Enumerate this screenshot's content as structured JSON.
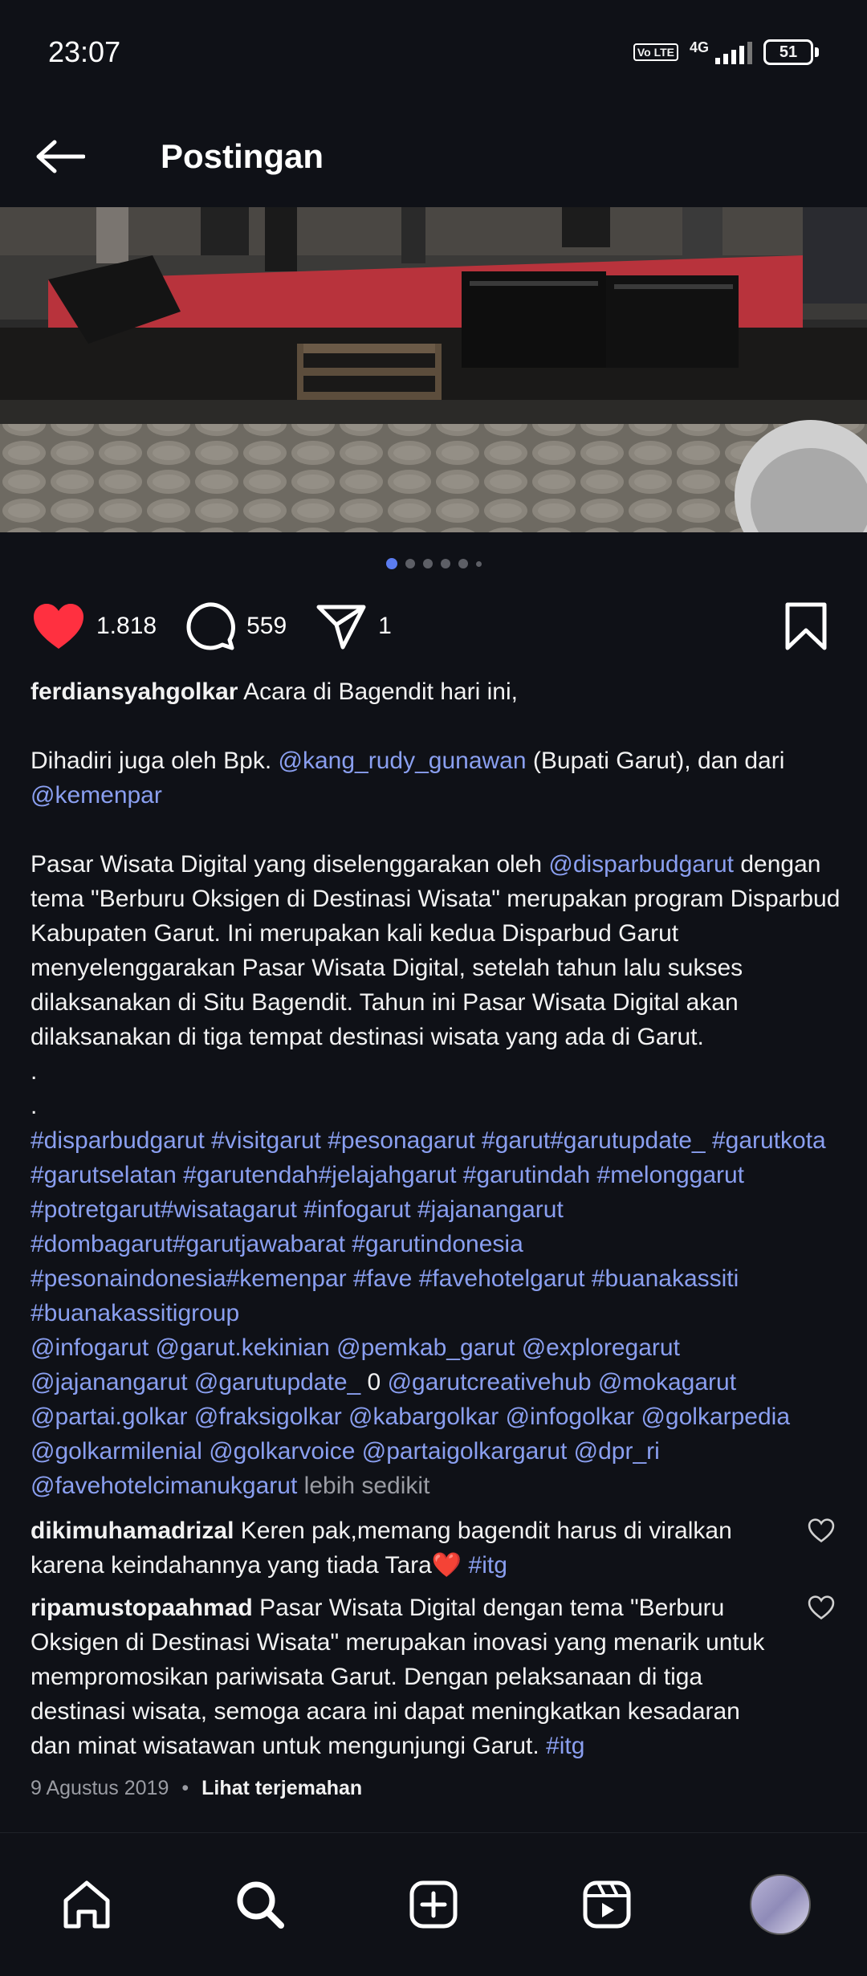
{
  "status": {
    "time": "23:07",
    "network": "4G",
    "volte": "Vo LTE",
    "battery": "51"
  },
  "header": {
    "title": "Postingan"
  },
  "post": {
    "image_dots": 6,
    "active_dot": 0,
    "likes": "1.818",
    "comments": "559",
    "shares": "1",
    "caption": {
      "username": "ferdiansyahgolkar",
      "line1": "Acara di Bagendit hari ini,",
      "line2a": "Dihadiri juga oleh Bpk.",
      "mention1": "@kang_rudy_gunawan",
      "line2b": "(Bupati Garut), dan dari",
      "mention2": "@kemenpar",
      "para3a": "Pasar Wisata Digital yang diselenggarakan oleh",
      "mention3": "@disparbudgarut",
      "para3b": "dengan tema \"Berburu Oksigen di Destinasi Wisata\" merupakan program Disparbud Kabupaten Garut. Ini merupakan kali kedua Disparbud Garut menyelenggarakan Pasar Wisata Digital, setelah tahun lalu sukses dilaksanakan di Situ Bagendit. Tahun ini Pasar Wisata Digital akan dilaksanakan di tiga tempat destinasi wisata yang ada di Garut.",
      "dot1": ".",
      "dot2": ".",
      "hashtags": "#disparbudgarut #visitgarut #pesonagarut #garut#garutupdate_ #garutkota #garutselatan #garutendah#jelajahgarut #garutindah #melonggarut #potretgarut#wisatagarut #infogarut #jajanangarut #dombagarut#garutjawabarat #garutindonesia #pesonaindonesia#kemenpar #fave #favehotelgarut #buanakassiti #buanakassitigroup",
      "mentions_a": "@infogarut @garut.kekinian @pemkab_garut @exploregarut @jajanangarut @garutupdate_",
      "mentions_zero": "0",
      "mentions_b": "@garutcreativehub @mokagarut @partai.golkar @fraksigolkar @kabargolkar @infogolkar @golkarpedia @golkarmilenial @golkarvoice @partaigolkargarut @dpr_ri @favehotelcimanukgarut",
      "less": "lebih sedikit"
    },
    "comments_list": [
      {
        "username": "dikimuhamadrizal",
        "text": "Keren pak,memang bagendit harus di viralkan karena keindahannya yang tiada Tara",
        "emoji": "❤️",
        "tag": "#itg"
      },
      {
        "username": "ripamustopaahmad",
        "text": "Pasar Wisata Digital dengan tema \"Berburu Oksigen di Destinasi Wisata\" merupakan inovasi yang menarik untuk mempromosikan pariwisata Garut. Dengan pelaksanaan di tiga destinasi wisata, semoga acara ini dapat meningkatkan kesadaran dan minat wisatawan untuk mengunjungi Garut.",
        "tag": "#itg"
      }
    ],
    "date": "9 Agustus 2019",
    "separator": "•",
    "translate": "Lihat terjemahan"
  },
  "nav": {
    "items": [
      "home-icon",
      "search-icon",
      "create-icon",
      "reels-icon",
      "profile-avatar"
    ]
  },
  "colors": {
    "background": "#0f1117",
    "link": "#8a9ff0",
    "like": "#ff3040",
    "active_dot": "#5b7cf0"
  }
}
